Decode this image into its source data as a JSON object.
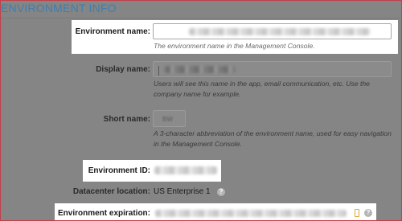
{
  "section": {
    "title": "ENVIRONMENT INFO"
  },
  "environment_name": {
    "label": "Environment name:",
    "help": "The environment name in the Management Console."
  },
  "display_name": {
    "label": "Display name:",
    "help_line1": "Users will see this name in the app, email communication, etc. Use the",
    "help_line2": "company name for example."
  },
  "short_name": {
    "label": "Short name:",
    "value": "BW",
    "help_line1": "A 3-character abbreviation of the environment name, used for easy navigation",
    "help_line2": "in the Management Console."
  },
  "environment_id": {
    "label": "Environment ID:"
  },
  "datacenter": {
    "label": "Datacenter location:",
    "value": "US Enterprise 1",
    "info_icon": "info-circle-icon"
  },
  "expiration": {
    "label": "Environment expiration:",
    "copy_icon": "copy-icon",
    "info_icon": "info-circle-icon"
  },
  "colors": {
    "accent": "#3c7fb0",
    "overlay": "#858585",
    "highlight": "#ffffff",
    "frame_border": "#c0404a",
    "copy_icon": "#e2a532"
  }
}
